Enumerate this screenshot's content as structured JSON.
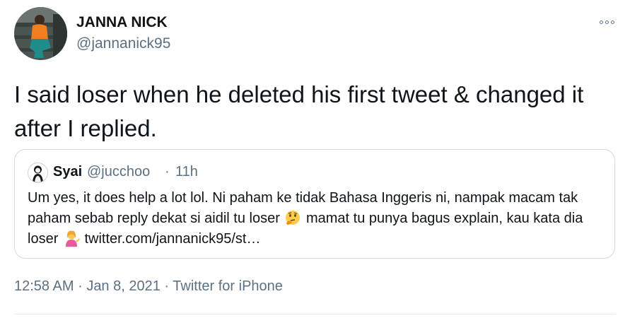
{
  "author": {
    "name": "JANNA NICK",
    "handle": "@jannanick95"
  },
  "tweet": {
    "text": "I said loser when he deleted his first tweet & changed it after I replied."
  },
  "quoted_tweet": {
    "name": "Syai",
    "handle": "@jucchoo",
    "separator": "·",
    "time": "11h",
    "text_part1": "Um yes, it does help a lot lol. Ni paham ke tidak Bahasa Inggeris ni, nampak macam tak paham sebab reply dekat si aidil tu loser ",
    "text_part2": " mamat tu punya bagus explain, kau kata dia loser ",
    "text_part3": " twitter.com/jannanick95/st…"
  },
  "meta": {
    "time": "12:58 AM",
    "sep1": "·",
    "date": "Jan 8, 2021",
    "sep2": "·",
    "source": "Twitter for iPhone"
  },
  "icons": {
    "more": "more-horizontal-icon",
    "thinking_emoji": "thinking-face-emoji",
    "person_emoji": "person-tipping-hand-emoji"
  },
  "colors": {
    "text": "#0f1419",
    "secondary": "#5b7083",
    "border": "#cfd9de"
  }
}
